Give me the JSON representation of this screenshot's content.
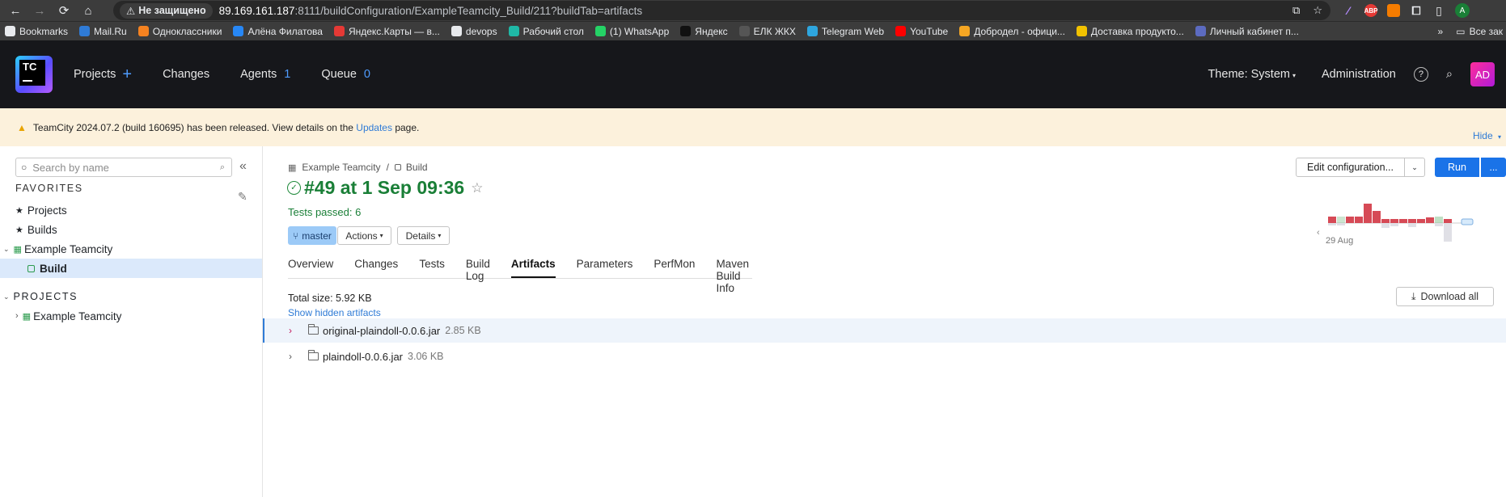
{
  "browser": {
    "security_label": "Не защищено",
    "url_host": "89.169.161.187",
    "url_rest": ":8111/buildConfiguration/ExampleTeamcity_Build/211?buildTab=artifacts",
    "profile_initial": "A"
  },
  "bookmarks": [
    {
      "label": "Bookmarks",
      "icon": "bookmarks-icon",
      "color": "#e8eaed"
    },
    {
      "label": "Mail.Ru",
      "icon": "mail-icon",
      "color": "#2f7bd6"
    },
    {
      "label": "Одноклассники",
      "icon": "ok-icon",
      "color": "#f58220"
    },
    {
      "label": "Алёна Филатова",
      "icon": "vk-icon",
      "color": "#2787f5"
    },
    {
      "label": "Яндекс.Карты — в...",
      "icon": "map-pin-icon",
      "color": "#e53935"
    },
    {
      "label": "devops",
      "icon": "folder-icon",
      "color": "#e8eaed"
    },
    {
      "label": "Рабочий стол",
      "icon": "desktop-icon",
      "color": "#1fb8a6"
    },
    {
      "label": "(1) WhatsApp",
      "icon": "whatsapp-icon",
      "color": "#25d366"
    },
    {
      "label": "Яндекс",
      "icon": "yandex-icon",
      "color": "#111"
    },
    {
      "label": "ЕЛК ЖКХ",
      "icon": "elk-icon",
      "color": "#555"
    },
    {
      "label": "Telegram Web",
      "icon": "telegram-icon",
      "color": "#2ea6df"
    },
    {
      "label": "YouTube",
      "icon": "youtube-icon",
      "color": "#ff0000"
    },
    {
      "label": "Добродел - офици...",
      "icon": "dobrodel-icon",
      "color": "#f5a623"
    },
    {
      "label": "Доставка продукто...",
      "icon": "delivery-icon",
      "color": "#f2c200"
    },
    {
      "label": "Личный кабинет п...",
      "icon": "cabinet-icon",
      "color": "#5c6bc0"
    }
  ],
  "bookmarks_overflow": "»",
  "bookmarks_other": "Все зак",
  "header": {
    "logo_text": "TC",
    "nav": [
      {
        "label": "Projects",
        "count": "",
        "plus": true
      },
      {
        "label": "Changes",
        "count": ""
      },
      {
        "label": "Agents",
        "count": "1"
      },
      {
        "label": "Queue",
        "count": "0"
      }
    ],
    "theme": "Theme: System",
    "administration": "Administration",
    "avatar": "AD"
  },
  "notice": {
    "prefix": "TeamCity 2024.07.2 (build 160695) has been released. View details on the ",
    "link": "Updates",
    "suffix": " page.",
    "hide": "Hide"
  },
  "sidebar": {
    "search_placeholder": "Search by name",
    "favorites_title": "FAVORITES",
    "favorites": [
      "Projects",
      "Builds"
    ],
    "project": "Example Teamcity",
    "build": "Build",
    "projects_title": "PROJECTS",
    "projects": [
      "Example Teamcity"
    ]
  },
  "build": {
    "crumb_project": "Example Teamcity",
    "crumb_sep": "/",
    "crumb_build": "Build",
    "title": "#49 at 1 Sep 09:36",
    "tests": "Tests passed: 6",
    "branch": "master",
    "actions": "Actions",
    "details": "Details",
    "edit_configuration": "Edit configuration...",
    "run": "Run",
    "run_more": "...",
    "history_label": "29 Aug"
  },
  "tabs": [
    "Overview",
    "Changes",
    "Tests",
    "Build Log",
    "Artifacts",
    "Parameters",
    "PerfMon",
    "Maven Build Info"
  ],
  "active_tab": "Artifacts",
  "artifacts": {
    "total_size": "Total size: 5.92 KB",
    "show_hidden": "Show hidden artifacts",
    "download_all": "Download all",
    "items": [
      {
        "name": "original-plaindoll-0.0.6.jar",
        "size": "2.85 KB"
      },
      {
        "name": "plaindoll-0.0.6.jar",
        "size": "3.06 KB"
      }
    ]
  },
  "colors": {
    "success": "#1a7f37",
    "link": "#2f7bd6",
    "run_button": "#1a73e8",
    "history_fail": "#d64a56",
    "history_ok": "#7fbf8a"
  }
}
